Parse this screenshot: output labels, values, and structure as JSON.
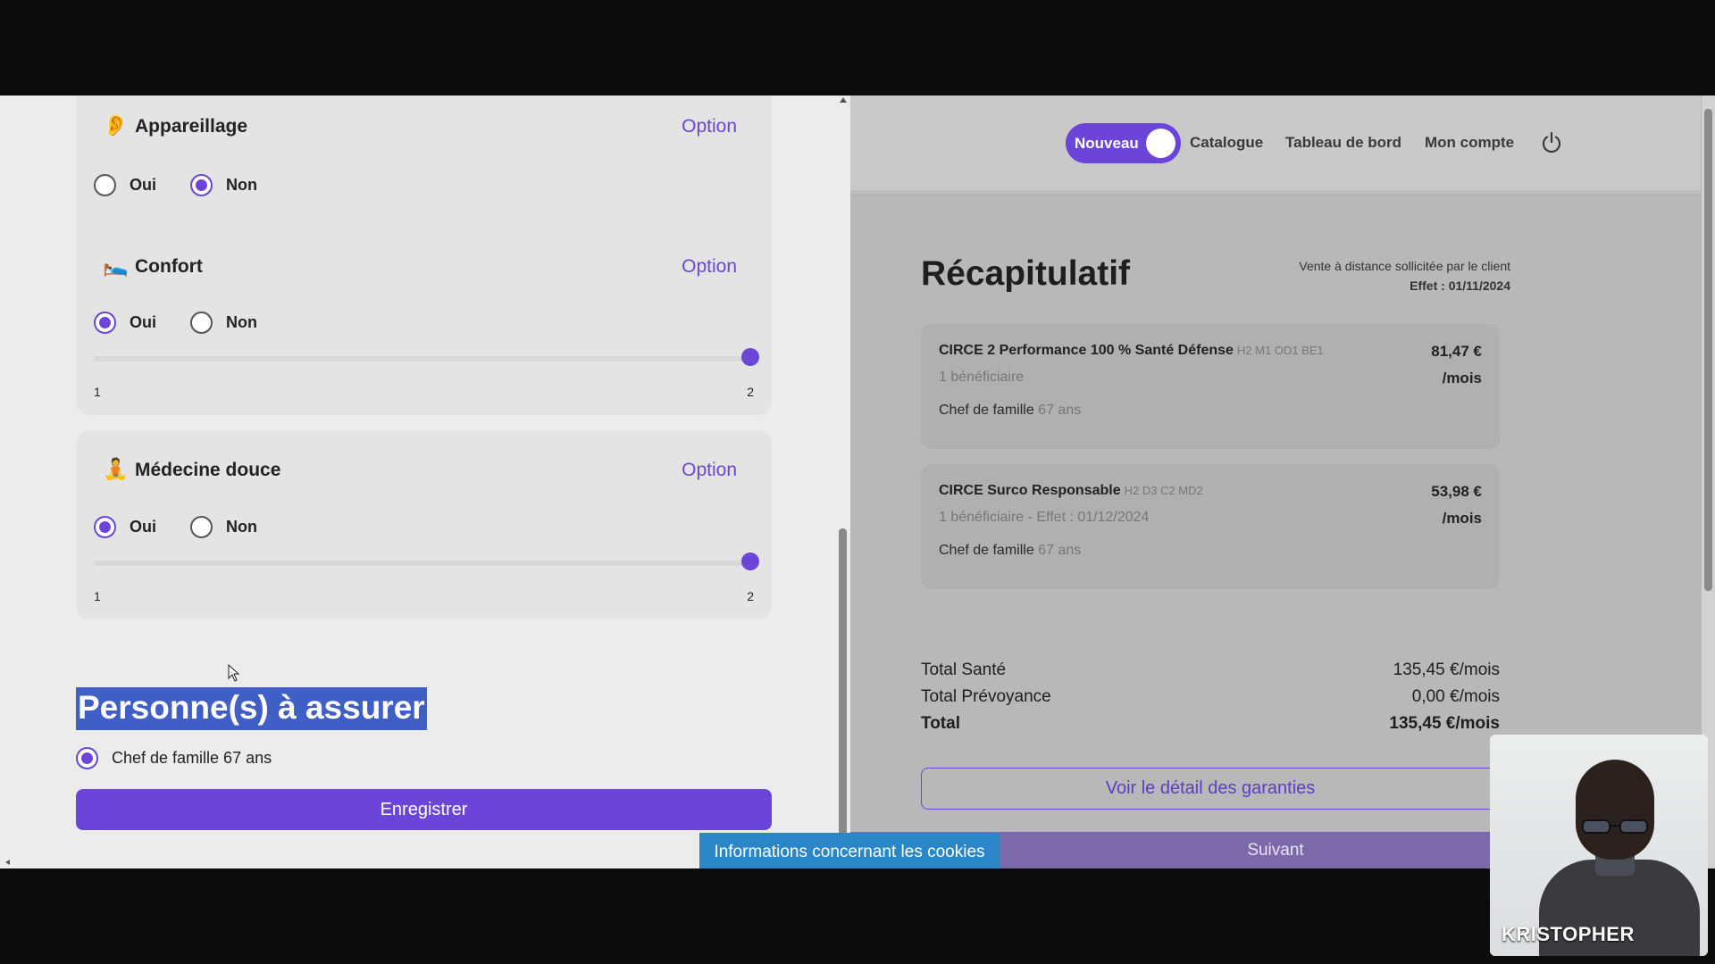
{
  "left": {
    "cards": [
      {
        "icon": "ear-icon",
        "emoji": "👂",
        "title": "Appareillage",
        "option": "Option",
        "yes": "Oui",
        "no": "Non",
        "selected": "Non"
      },
      {
        "icon": "bed-icon",
        "emoji": "🛌",
        "title": "Confort",
        "option": "Option",
        "yes": "Oui",
        "no": "Non",
        "selected": "Oui",
        "slider": {
          "min": "1",
          "max": "2",
          "value": 2
        }
      },
      {
        "icon": "meditation-icon",
        "emoji": "🧘",
        "title": "Médecine douce",
        "option": "Option",
        "yes": "Oui",
        "no": "Non",
        "selected": "Oui",
        "slider": {
          "min": "1",
          "max": "2",
          "value": 2
        }
      }
    ],
    "section_title": "Personne(s) à assurer",
    "person": "Chef de famille 67 ans",
    "save_label": "Enregistrer"
  },
  "right": {
    "nav": {
      "toggle_label": "Nouveau",
      "links": [
        "Catalogue",
        "Tableau de bord",
        "Mon compte"
      ]
    },
    "recap": {
      "title": "Récapitulatif",
      "subtitle_line1": "Vente à distance sollicitée par le client",
      "subtitle_line2": "Effet : 01/11/2024"
    },
    "plans": [
      {
        "name": "CIRCE 2 Performance 100 % Santé Défense",
        "codes": "H2 M1 OD1 BE1",
        "sub": "1 bénéficiaire",
        "beneficiary": "Chef de famille",
        "age": "67 ans",
        "price": "81,47 €",
        "per": "/mois"
      },
      {
        "name": "CIRCE Surco Responsable",
        "codes": "H2 D3 C2 MD2",
        "sub": "1 bénéficiaire - Effet : 01/12/2024",
        "beneficiary": "Chef de famille",
        "age": "67 ans",
        "price": "53,98 €",
        "per": "/mois"
      }
    ],
    "totals": [
      {
        "label": "Total Santé",
        "value": "135,45 €/mois"
      },
      {
        "label": "Total Prévoyance",
        "value": "0,00 €/mois"
      },
      {
        "label": "Total",
        "value": "135,45 €/mois"
      }
    ],
    "detail_button": "Voir le détail des garanties",
    "next_button": "Suivant"
  },
  "cookie_bar": "Informations concernant les cookies",
  "video": {
    "name": "KRISTOPHER"
  },
  "colors": {
    "accent": "#6a45d8",
    "cookie": "#2a86c6",
    "selection": "#3f5fc6"
  }
}
